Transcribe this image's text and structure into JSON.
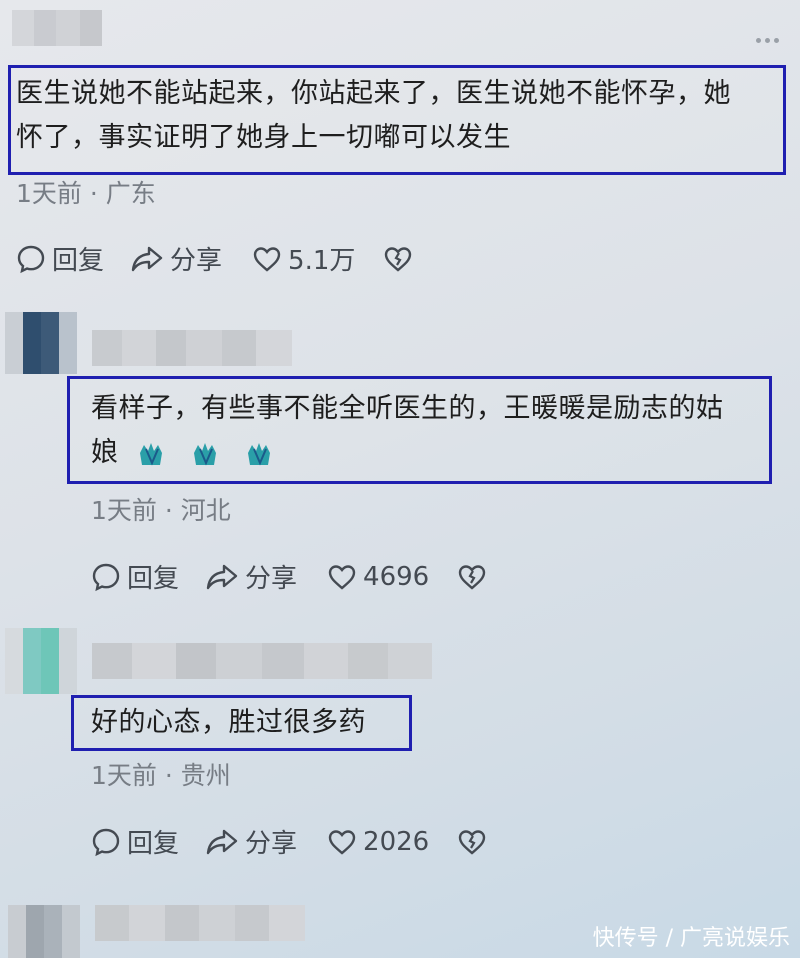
{
  "thread": {
    "comments": [
      {
        "text": "医生说她不能站起来，你站起来了，医生说她不能怀孕，她怀了，事实证明了她身上一切嘟可以发生",
        "text_line1": "医生说她不能站起来，你站起来了，医生说她不能怀孕，她",
        "text_line2": "怀了，事实证明了她身上一切嘟可以发生",
        "time": "1天前 · 广东",
        "reply_label": "回复",
        "share_label": "分享",
        "likes": "5.1万"
      },
      {
        "text_line1": "看样子，有些事不能全听医生的，王暖暖是励志的姑",
        "text_line2": "娘",
        "emoji": "applause-hands-emoji",
        "time": "1天前 · 河北",
        "reply_label": "回复",
        "share_label": "分享",
        "likes": "4696"
      },
      {
        "text_line1": "好的心态，胜过很多药",
        "time": "1天前 · 贵州",
        "reply_label": "回复",
        "share_label": "分享",
        "likes": "2026"
      }
    ]
  },
  "watermark": "快传号 / 广亮说娱乐",
  "colors": {
    "highlight_box": "#1f1fb0",
    "meta_text": "#777d85",
    "action_text": "#444a52"
  },
  "icons": [
    "more-icon",
    "comment-icon",
    "share-icon",
    "heart-icon",
    "dislike-icon"
  ]
}
